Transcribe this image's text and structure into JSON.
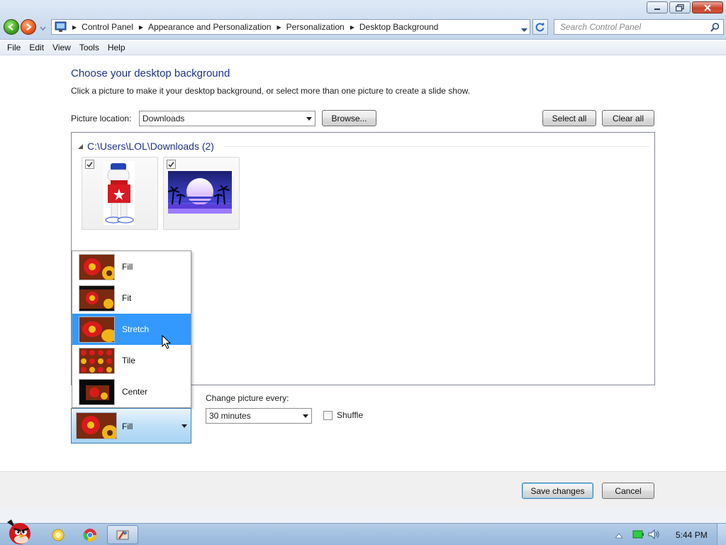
{
  "window": {
    "address_crumbs": [
      "Control Panel",
      "Appearance and Personalization",
      "Personalization",
      "Desktop Background"
    ],
    "search_placeholder": "Search Control Panel"
  },
  "menu": [
    "File",
    "Edit",
    "View",
    "Tools",
    "Help"
  ],
  "page": {
    "title": "Choose your desktop background",
    "description": "Click a picture to make it your desktop background, or select more than one picture to create a slide show.",
    "picture_location_label": "Picture location:",
    "picture_location_value": "Downloads",
    "browse_label": "Browse...",
    "select_all_label": "Select all",
    "clear_all_label": "Clear all",
    "group_header": "C:\\Users\\LOL\\Downloads (2)",
    "thumbnails": [
      {
        "checked": true,
        "subject": "cartoon-character"
      },
      {
        "checked": true,
        "subject": "synthwave-sunset"
      }
    ]
  },
  "picture_position": {
    "options": [
      "Fill",
      "Fit",
      "Stretch",
      "Tile",
      "Center"
    ],
    "highlighted": "Stretch",
    "selected": "Fill"
  },
  "slideshow": {
    "change_label": "Change picture every:",
    "interval_value": "30 minutes",
    "shuffle_label": "Shuffle",
    "shuffle_checked": false
  },
  "actions": {
    "save_label": "Save changes",
    "cancel_label": "Cancel"
  },
  "taskbar": {
    "time": "5:44 PM"
  },
  "colors": {
    "title_blue": "#1e3287",
    "highlight": "#3399ff"
  }
}
